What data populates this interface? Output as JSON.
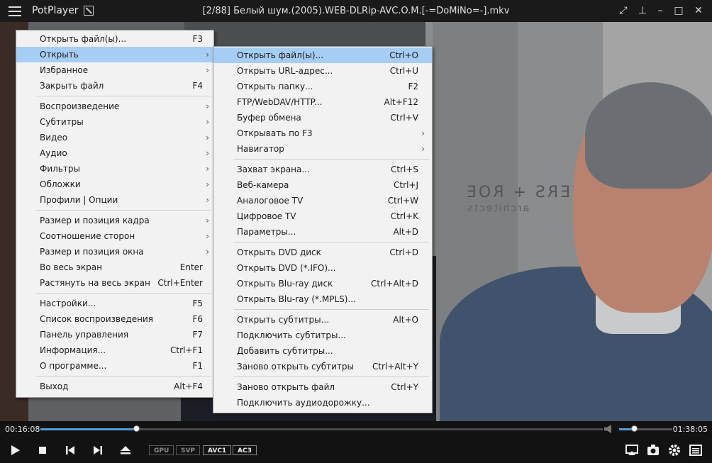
{
  "app": {
    "name": "PotPlayer",
    "window_title": "[2/88] Белый шум.(2005).WEB-DLRip-AVC.O.M.[-=DoMiNo=-].mkv"
  },
  "video": {
    "sign_text": "VERS + ROE",
    "sign_sub": "architects"
  },
  "main_menu": [
    {
      "label": "Открыть файл(ы)...",
      "shortcut": "F3"
    },
    {
      "label": "Открыть",
      "arrow": "›",
      "highlighted": true
    },
    {
      "label": "Избранное",
      "arrow": "›"
    },
    {
      "label": "Закрыть файл",
      "shortcut": "F4"
    },
    {
      "separator": true
    },
    {
      "label": "Воспроизведение",
      "arrow": "›"
    },
    {
      "label": "Субтитры",
      "arrow": "›"
    },
    {
      "label": "Видео",
      "arrow": "›"
    },
    {
      "label": "Аудио",
      "arrow": "›"
    },
    {
      "label": "Фильтры",
      "arrow": "›"
    },
    {
      "label": "Обложки",
      "arrow": "›"
    },
    {
      "label": "Профили | Опции",
      "arrow": "›"
    },
    {
      "separator": true
    },
    {
      "label": "Размер и позиция кадра",
      "arrow": "›"
    },
    {
      "label": "Соотношение сторон",
      "arrow": "›"
    },
    {
      "label": "Размер и позиция окна",
      "arrow": "›"
    },
    {
      "label": "Во весь экран",
      "shortcut": "Enter"
    },
    {
      "label": "Растянуть на весь экран",
      "shortcut": "Ctrl+Enter"
    },
    {
      "separator": true
    },
    {
      "label": "Настройки...",
      "shortcut": "F5"
    },
    {
      "label": "Список воспроизведения",
      "shortcut": "F6"
    },
    {
      "label": "Панель управления",
      "shortcut": "F7"
    },
    {
      "label": "Информация...",
      "shortcut": "Ctrl+F1"
    },
    {
      "label": "О программе...",
      "shortcut": "F1"
    },
    {
      "separator": true
    },
    {
      "label": "Выход",
      "shortcut": "Alt+F4"
    }
  ],
  "sub_menu": [
    {
      "label": "Открыть файл(ы)...",
      "shortcut": "Ctrl+O",
      "highlighted": true
    },
    {
      "label": "Открыть URL-адрес...",
      "shortcut": "Ctrl+U"
    },
    {
      "label": "Открыть папку...",
      "shortcut": "F2"
    },
    {
      "label": "FTP/WebDAV/HTTP...",
      "shortcut": "Alt+F12"
    },
    {
      "label": "Буфер обмена",
      "shortcut": "Ctrl+V"
    },
    {
      "label": "Открывать по F3",
      "arrow": "›"
    },
    {
      "label": "Навигатор",
      "arrow": "›"
    },
    {
      "separator": true
    },
    {
      "label": "Захват экрана...",
      "shortcut": "Ctrl+S"
    },
    {
      "label": "Веб-камера",
      "shortcut": "Ctrl+J"
    },
    {
      "label": "Аналоговое TV",
      "shortcut": "Ctrl+W"
    },
    {
      "label": "Цифровое TV",
      "shortcut": "Ctrl+K"
    },
    {
      "label": "Параметры...",
      "shortcut": "Alt+D"
    },
    {
      "separator": true
    },
    {
      "label": "Открыть DVD диск",
      "shortcut": "Ctrl+D"
    },
    {
      "label": "Открыть DVD (*.IFO)..."
    },
    {
      "label": "Открыть Blu-ray диск",
      "shortcut": "Ctrl+Alt+D"
    },
    {
      "label": "Открыть Blu-ray (*.MPLS)..."
    },
    {
      "separator": true
    },
    {
      "label": "Открыть субтитры...",
      "shortcut": "Alt+O"
    },
    {
      "label": "Подключить субтитры..."
    },
    {
      "label": "Добавить субтитры..."
    },
    {
      "label": "Заново открыть субтитры",
      "shortcut": "Ctrl+Alt+Y"
    },
    {
      "separator": true
    },
    {
      "label": "Заново открыть файл",
      "shortcut": "Ctrl+Y"
    },
    {
      "label": "Подключить аудиодорожку..."
    }
  ],
  "playback": {
    "current_time": "00:16:08",
    "duration": "01:38:05",
    "progress": 0.17,
    "volume": 0.28
  },
  "badges": [
    {
      "label": "GPU",
      "active": false
    },
    {
      "label": "SVP",
      "active": false
    },
    {
      "label": "AVC1",
      "active": true
    },
    {
      "label": "AC3",
      "active": true
    }
  ],
  "colors": {
    "accent": "#4f9fe0",
    "menu_highlight": "#a6cdf4",
    "menu_bg": "#f2f2f2"
  },
  "icons": [
    "hamburger-menu-icon",
    "pin-icon",
    "fullscreen-icon",
    "always-on-top-icon",
    "minimize-icon",
    "maximize-icon",
    "close-icon",
    "play-icon",
    "stop-icon",
    "previous-icon",
    "next-icon",
    "eject-icon",
    "volume-icon",
    "screen-cast-icon",
    "capture-icon",
    "settings-icon",
    "playlist-icon"
  ]
}
